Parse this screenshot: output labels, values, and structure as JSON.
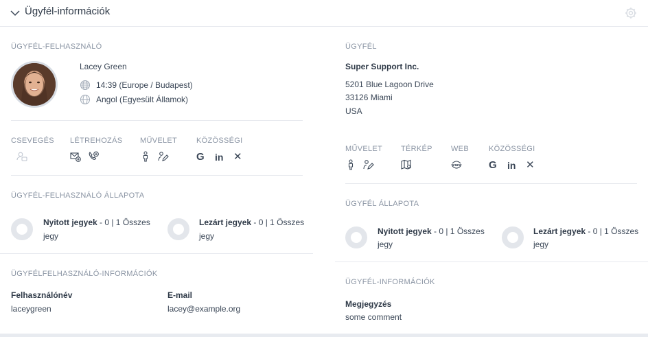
{
  "header": {
    "title": "Ügyfél-információk"
  },
  "left": {
    "customer_user": {
      "section": "ÜGYFÉL-FELHASZNÁLÓ",
      "name": "Lacey Green",
      "time": "14:39 (Europe / Budapest)",
      "language": "Angol (Egyesült Államok)"
    },
    "actions": {
      "chat": "CSEVEGÉS",
      "create": "LÉTREHOZÁS",
      "operation": "MŰVELET",
      "social": "KÖZÖSSÉGI"
    },
    "status": {
      "section": "ÜGYFÉL-FELHASZNÁLÓ ÁLLAPOTA",
      "open_label": "Nyitott jegyek",
      "open_text": " - 0 | 1 Összes",
      "open_unit": "jegy",
      "closed_label": "Lezárt jegyek",
      "closed_text": " - 0 | 1 Összes",
      "closed_unit": "jegy"
    },
    "info": {
      "section": "ÜGYFÉLFELHASZNÁLÓ-INFORMÁCIÓK",
      "username_label": "Felhasználónév",
      "username_value": "laceygreen",
      "email_label": "E-mail",
      "email_value": "lacey@example.org"
    }
  },
  "right": {
    "customer": {
      "section": "ÜGYFÉL",
      "company": "Super Support Inc.",
      "street": "5201 Blue Lagoon Drive",
      "city": "33126 Miami",
      "country": "USA"
    },
    "actions": {
      "operation": "MŰVELET",
      "map": "TÉRKÉP",
      "web": "WEB",
      "social": "KÖZÖSSÉGI"
    },
    "status": {
      "section": "ÜGYFÉL ÁLLAPOTA",
      "open_label": "Nyitott jegyek",
      "open_text": " - 0 | 1 Összes",
      "open_unit": "jegy",
      "closed_label": "Lezárt jegyek",
      "closed_text": " - 0 | 1 Összes",
      "closed_unit": "jegy"
    },
    "info": {
      "section": "ÜGYFÉL-INFORMÁCIÓK",
      "note_label": "Megjegyzés",
      "note_value": "some comment"
    }
  },
  "icons": {
    "google": "G",
    "linkedin": "in",
    "xing": "✕"
  }
}
